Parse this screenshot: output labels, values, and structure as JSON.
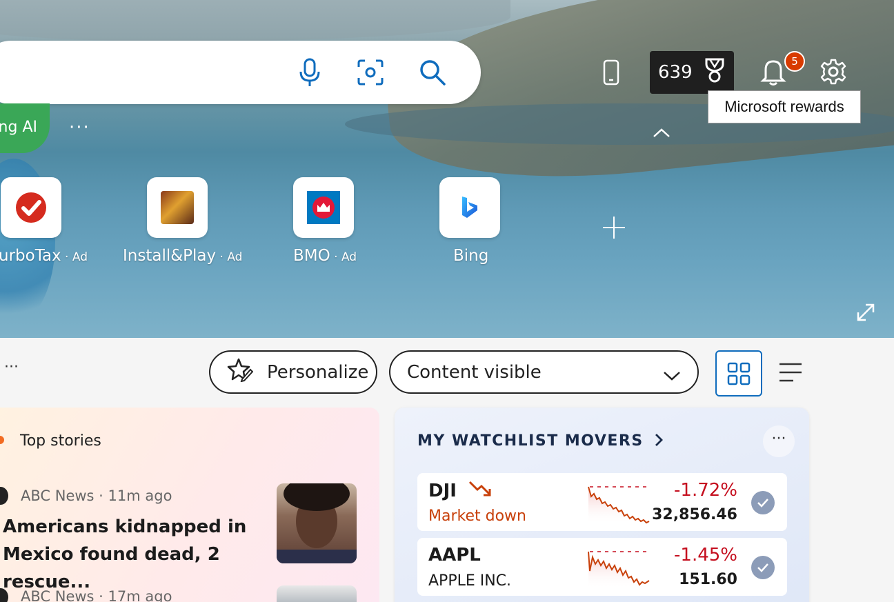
{
  "search": {
    "placeholder": ""
  },
  "bing_pill": {
    "label": "ng AI"
  },
  "topbar": {
    "rewards_points": "639",
    "notification_count": "5",
    "tooltip": "Microsoft rewards"
  },
  "quicklinks": [
    {
      "label": "urboTax",
      "ad": " · Ad"
    },
    {
      "label": "Install&Play",
      "ad": " · Ad"
    },
    {
      "label": "BMO",
      "ad": " · Ad"
    },
    {
      "label": "Bing",
      "ad": ""
    }
  ],
  "toolbar": {
    "personalize_label": "Personalize",
    "content_select": "Content visible"
  },
  "top_stories": {
    "title": "Top stories",
    "items": [
      {
        "source": "ABC News · 11m ago",
        "headline": "Americans kidnapped in Mexico found dead, 2 rescue..."
      },
      {
        "source": "ABC News · 17m ago",
        "headline": ""
      }
    ]
  },
  "watchlist": {
    "title": "MY WATCHLIST MOVERS",
    "stocks": [
      {
        "symbol": "DJI",
        "subtitle": "Market down",
        "change": "-1.72%",
        "price": "32,856.46"
      },
      {
        "symbol": "AAPL",
        "subtitle": "APPLE INC.",
        "change": "-1.45%",
        "price": "151.60"
      }
    ]
  },
  "colors": {
    "accent": "#0f6cbd",
    "down": "#c50f1f",
    "badge": "#d83b01"
  }
}
